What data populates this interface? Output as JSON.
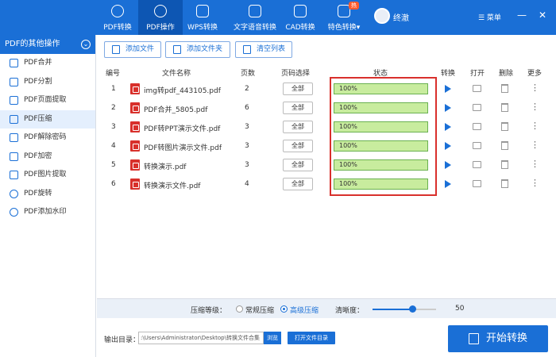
{
  "nav": {
    "items": [
      {
        "label": "PDF转换",
        "icon": "exchange-icon"
      },
      {
        "label": "PDF操作",
        "icon": "gear-icon"
      },
      {
        "label": "WPS转换",
        "icon": "wps-icon"
      },
      {
        "label": "文字语音转换",
        "icon": "audio-icon"
      },
      {
        "label": "CAD转换",
        "icon": "download-icon"
      },
      {
        "label": "特色转换▾",
        "icon": "gift-icon"
      }
    ],
    "hot_badge": "热",
    "user_name": "终澈",
    "menu_label": "☰ 菜单",
    "min_glyph": "—",
    "close_glyph": "✕"
  },
  "sidebar": {
    "title": "PDF的其他操作",
    "chevron": "⌄",
    "items": [
      {
        "label": "PDF合并"
      },
      {
        "label": "PDF分割"
      },
      {
        "label": "PDF页面提取"
      },
      {
        "label": "PDF压缩"
      },
      {
        "label": "PDF解除密码"
      },
      {
        "label": "PDF加密"
      },
      {
        "label": "PDF图片提取"
      },
      {
        "label": "PDF旋转"
      },
      {
        "label": "PDF添加水印"
      }
    ]
  },
  "toolbar": {
    "add_file": "添加文件",
    "add_folder": "添加文件夹",
    "clear_list": "清空列表"
  },
  "table": {
    "headers": {
      "num": "编号",
      "name": "文件名称",
      "pages": "页数",
      "page_select": "页码选择",
      "status": "状态",
      "convert": "转换",
      "open": "打开",
      "delete": "删除",
      "more": "更多"
    },
    "rows": [
      {
        "num": "1",
        "name": "img转pdf_443105.pdf",
        "pages": "2",
        "select": "全部",
        "progress_text": "100%",
        "progress": 1.0
      },
      {
        "num": "2",
        "name": "PDF合并_5805.pdf",
        "pages": "6",
        "select": "全部",
        "progress_text": "100%",
        "progress": 1.0
      },
      {
        "num": "3",
        "name": "PDF转PPT演示文件.pdf",
        "pages": "3",
        "select": "全部",
        "progress_text": "100%",
        "progress": 1.0
      },
      {
        "num": "4",
        "name": "PDF转图片演示文件.pdf",
        "pages": "3",
        "select": "全部",
        "progress_text": "100%",
        "progress": 1.0
      },
      {
        "num": "5",
        "name": "转换演示.pdf",
        "pages": "3",
        "select": "全部",
        "progress_text": "100%",
        "progress": 1.0
      },
      {
        "num": "6",
        "name": "转换演示文件.pdf",
        "pages": "4",
        "select": "全部",
        "progress_text": "100%",
        "progress": 1.0
      }
    ],
    "more_glyph": "⋮"
  },
  "compression": {
    "level_label": "压缩等级：",
    "normal": "常规压缩",
    "advanced": "高级压缩",
    "selected": "advanced",
    "clarity_label": "清晰度：",
    "clarity_value": "50",
    "clarity_fraction": 0.625
  },
  "output": {
    "label": "输出目录：",
    "path": ":\\Users\\Administrator\\Desktop\\转换文件合集",
    "browse": "浏览",
    "open_dir": "打开文件目录",
    "start": "开始转换"
  },
  "colors": {
    "brand": "#1a6fd6",
    "progress_fill": "#c8ec9e",
    "highlight_border": "#d9302c",
    "pdf_icon": "#d8302b"
  }
}
